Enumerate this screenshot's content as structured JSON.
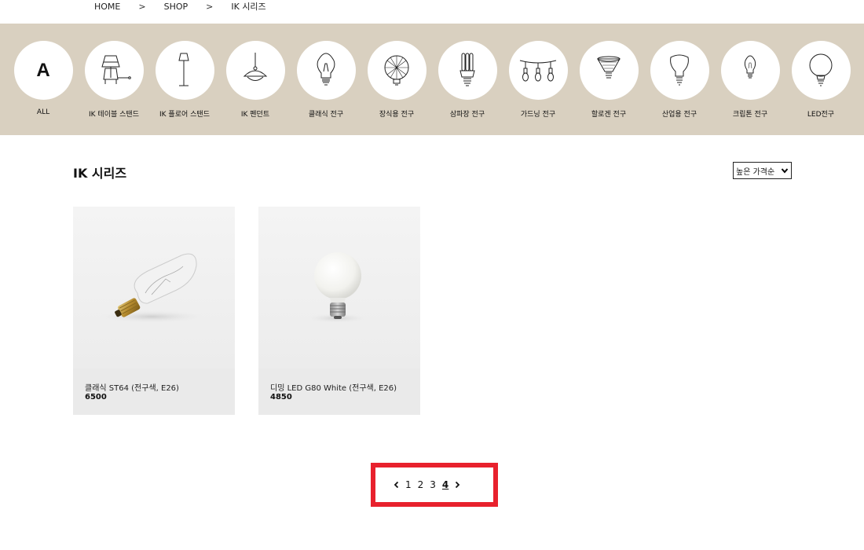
{
  "breadcrumb": {
    "items": [
      "HOME",
      "SHOP",
      "IK 시리즈"
    ],
    "separator": ">"
  },
  "categories": {
    "items": [
      {
        "label": "ALL",
        "icon": "all-letter-icon",
        "glyph": "A"
      },
      {
        "label": "IK 테이블 스탠드",
        "icon": "table-stand-icon"
      },
      {
        "label": "IK 플로어 스탠드",
        "icon": "floor-stand-icon"
      },
      {
        "label": "IK 펜던트",
        "icon": "pendant-icon"
      },
      {
        "label": "클래식 전구",
        "icon": "classic-bulb-icon"
      },
      {
        "label": "장식용 전구",
        "icon": "decorative-bulb-icon"
      },
      {
        "label": "삼파장 전구",
        "icon": "triple-wave-bulb-icon"
      },
      {
        "label": "가드닝 전구",
        "icon": "gardening-bulb-icon"
      },
      {
        "label": "할로겐 전구",
        "icon": "halogen-bulb-icon"
      },
      {
        "label": "산업용 전구",
        "icon": "industrial-bulb-icon"
      },
      {
        "label": "크립톤 전구",
        "icon": "krypton-bulb-icon"
      },
      {
        "label": "LED전구",
        "icon": "led-bulb-icon"
      }
    ],
    "background_color": "#d9d0c0"
  },
  "main": {
    "title": "IK 시리즈",
    "sort": {
      "selected": "높은 가격순"
    }
  },
  "products": [
    {
      "name": "클래식 ST64 (전구색, E26)",
      "price": "6500",
      "image_icon": "edison-bulb-icon"
    },
    {
      "name": "디밍 LED G80 White (전구색, E26)",
      "price": "4850",
      "image_icon": "globe-bulb-icon"
    }
  ],
  "pagination": {
    "pages": [
      "1",
      "2",
      "3",
      "4"
    ],
    "current": "4",
    "highlight_color": "#e8212d"
  }
}
